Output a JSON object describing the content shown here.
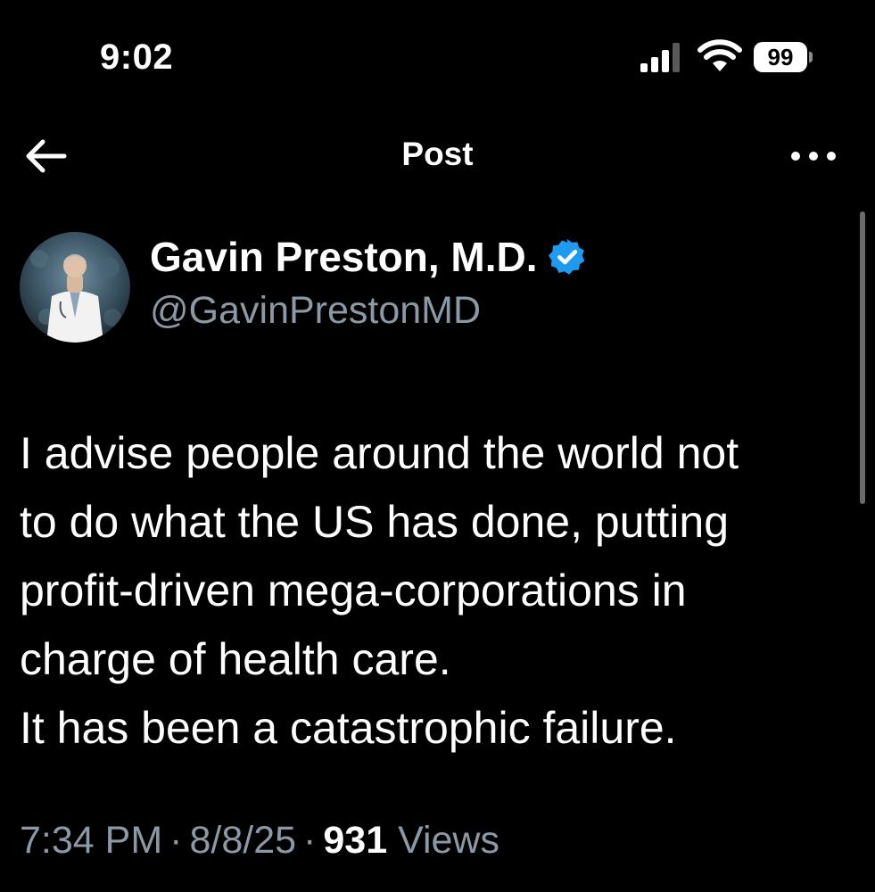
{
  "status_bar": {
    "time": "9:02",
    "battery_level": "99"
  },
  "nav": {
    "title": "Post"
  },
  "author": {
    "display_name": "Gavin Preston, M.D.",
    "handle": "@GavinPrestonMD",
    "verified": true
  },
  "tweet": {
    "lines": [
      "I advise people around the world not",
      "to do what the US has done, putting",
      "profit-driven mega-corporations in",
      "charge of health care.",
      "It has been a catastrophic failure."
    ]
  },
  "meta": {
    "time": "7:34 PM",
    "date": "8/8/25",
    "separator": "·",
    "views_count": "931",
    "views_label": "Views"
  },
  "colors": {
    "background": "#000000",
    "text_primary": "#ffffff",
    "text_secondary": "#8b98a5",
    "verified_badge": "#1d9bf0"
  }
}
